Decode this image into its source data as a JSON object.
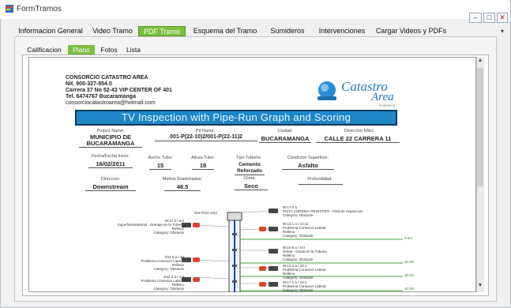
{
  "window": {
    "title": "FormTramos",
    "controls": [
      "–",
      "□",
      "✕"
    ],
    "expand_arrow": "▾"
  },
  "tabs": [
    {
      "label": "Informacion General"
    },
    {
      "label": "Video Tramo"
    },
    {
      "label": "PDF Tramo",
      "active": true
    },
    {
      "label": "Esquema del Tramo"
    },
    {
      "label": "Sumideros"
    },
    {
      "label": "Intervenciones"
    },
    {
      "label": "Cargar Videos y PDFs"
    }
  ],
  "subtabs": [
    {
      "label": "Calificacion"
    },
    {
      "label": "Plano",
      "active": true
    },
    {
      "label": "Fotos"
    },
    {
      "label": "Lista"
    }
  ],
  "pdf": {
    "company": {
      "name": "CONSORCIO CATASTRO AREA",
      "nit": "Nit. 900-327-954.0",
      "address": "Carrera 37 No 52-43 VIP CENTER OF 401",
      "tel": "Tel. 6474767 Bucaramanga",
      "email": "consorciocatastroarea@hotmail.com"
    },
    "logo": {
      "text_top": "Catastro",
      "text_bottom": "Area",
      "tagline": "Consorcio"
    },
    "banner": "TV Inspection with Pipe-Run Graph and Scoring",
    "fields_row1": [
      {
        "label": "Project Name:",
        "value": "MUNICIPIO DE BUCARAMANGA"
      },
      {
        "label": "Pit Name:",
        "value": "001-P(22-10)2/001-P(22-11)2"
      },
      {
        "label": "Ciudad:",
        "value": "BUCARAMANGA"
      },
      {
        "label": "Direccion NNU:",
        "value": "CALLE 22 CARRERA 11"
      }
    ],
    "fields_row2": [
      {
        "label": "Fecha/Fecha Inicio:",
        "value": "16/02/2011"
      },
      {
        "label": "Ancho Tubo:",
        "value": "15"
      },
      {
        "label": "Altura Tubo:",
        "value": "18"
      },
      {
        "label": "Tipo Tuberia:",
        "value": "Cemento Reforzado"
      },
      {
        "label": "Condicion Superficie:",
        "value": "Asfalto"
      }
    ],
    "fields_row3": [
      {
        "label": "Direccion:",
        "value": "Downstream"
      },
      {
        "label": "Metros Examinados:",
        "value": "48.5"
      },
      {
        "label": "Clima:",
        "value": "Seco"
      },
      {
        "label": "Profundidad:",
        "value": ""
      }
    ],
    "graph": {
      "top_label": "001-P(22-10)2",
      "left_notes": [
        {
          "lines": [
            "W:17.0 / 6:0",
            "Superficie/Material - Drenaje en la Tuberia",
            "Relleno",
            "Category: Obstacle"
          ]
        },
        {
          "lines": [
            "3/11.5 a / 48",
            "Problema Conexion Lateral",
            "Relleno",
            "Category: Obstacle"
          ]
        },
        {
          "lines": [
            "4/11.3 a / 4:0",
            "Problema Conexion Lateral",
            "Relleno",
            "Category: Obstacle"
          ]
        }
      ],
      "right_notes": [
        {
          "lines": [
            "W:17.0 a",
            "PISTA CORRIDA REGISTRO - Final de Inspeccion",
            "Category: Obstacle"
          ]
        },
        {
          "lines": [
            "W:13.1 a / 10:11",
            "Problema Conexion Lateral",
            "Relleno",
            "Category: Obstacle"
          ]
        },
        {
          "lines": [
            "W:10.8 a / 6:0",
            "Grieta - Grieta en la Tuberia",
            "Relleno",
            "Category: Obstacle"
          ]
        },
        {
          "lines": [
            "W:13.2 a / 10:1",
            "Problema Conexion Lateral",
            "Relleno",
            "Category: Obstacle"
          ]
        },
        {
          "lines": [
            "W:17.1 a / 10:1",
            "Problema Conexion Lateral",
            "Category: Obstacle"
          ]
        }
      ],
      "green_tags": [
        "0.0m",
        "20.0m",
        "30.0m",
        "40.0m"
      ]
    }
  }
}
